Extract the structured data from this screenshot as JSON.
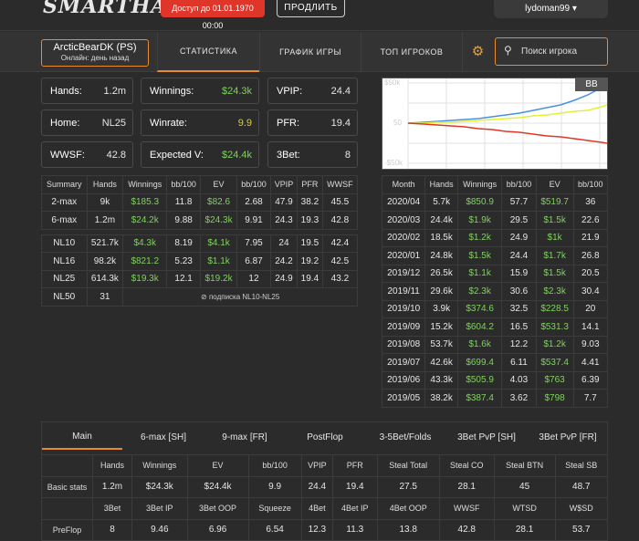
{
  "header": {
    "logo": "SMARTHAND",
    "subscription_badge": "Доступ до 01.01.1970 00:00",
    "renew_label": "ПРОДЛИТЬ",
    "username": "lydoman99"
  },
  "nav": {
    "player_name": "ArcticBearDK (PS)",
    "player_status": "Онлайн: день назад",
    "tabs": [
      "СТАТИСТИКА",
      "ГРАФИК ИГРЫ",
      "ТОП ИГРОКОВ"
    ],
    "active_tab": 0,
    "search_placeholder": "Поиск игрока"
  },
  "stats": [
    {
      "label": "Hands:",
      "value": "1.2m",
      "color": "white"
    },
    {
      "label": "Winnings:",
      "value": "$24.3k",
      "color": "green"
    },
    {
      "label": "VPIP:",
      "value": "24.4",
      "color": "white"
    },
    {
      "label": "Home:",
      "value": "NL25",
      "color": "white"
    },
    {
      "label": "Winrate:",
      "value": "9.9",
      "color": "yellow"
    },
    {
      "label": "PFR:",
      "value": "19.4",
      "color": "white"
    },
    {
      "label": "WWSF:",
      "value": "42.8",
      "color": "white"
    },
    {
      "label": "Expected V:",
      "value": "$24.4k",
      "color": "green"
    },
    {
      "label": "3Bet:",
      "value": "8",
      "color": "white"
    }
  ],
  "chart": {
    "tag": "BB",
    "y_labels": [
      "$50k",
      "50",
      "-$50k"
    ],
    "lines": [
      {
        "name": "EV",
        "color": "#4a90e2"
      },
      {
        "name": "Winnings",
        "color": "#e6f032"
      },
      {
        "name": "Red",
        "color": "#e0362a"
      }
    ]
  },
  "summary_table": {
    "headers": [
      "Summary",
      "Hands",
      "Winnings",
      "bb/100",
      "EV",
      "bb/100",
      "VPIP",
      "PFR",
      "WWSF"
    ],
    "rows": [
      [
        "2-max",
        "9k",
        "$185.3",
        "11.8",
        "$82.6",
        "2.68",
        "47.9",
        "38.2",
        "45.5"
      ],
      [
        "6-max",
        "1.2m",
        "$24.2k",
        "9.88",
        "$24.3k",
        "9.91",
        "24.3",
        "19.3",
        "42.8"
      ]
    ],
    "limit_rows": [
      [
        "NL10",
        "521.7k",
        "$4.3k",
        "8.19",
        "$4.1k",
        "7.95",
        "24",
        "19.5",
        "42.4"
      ],
      [
        "NL16",
        "98.2k",
        "$821.2",
        "5.23",
        "$1.1k",
        "6.87",
        "24.2",
        "19.2",
        "42.5"
      ],
      [
        "NL25",
        "614.3k",
        "$19.3k",
        "12.1",
        "$19.2k",
        "12",
        "24.9",
        "19.4",
        "43.2"
      ]
    ],
    "locked_row": {
      "limit": "NL50",
      "hands": "31",
      "note": "подписка NL10-NL25"
    }
  },
  "month_table": {
    "headers": [
      "Month",
      "Hands",
      "Winnings",
      "bb/100",
      "EV",
      "bb/100"
    ],
    "rows": [
      [
        "2020/04",
        "5.7k",
        "$850.9",
        "57.7",
        "$519.7",
        "36"
      ],
      [
        "2020/03",
        "24.4k",
        "$1.9k",
        "29.5",
        "$1.5k",
        "22.6"
      ],
      [
        "2020/02",
        "18.5k",
        "$1.2k",
        "24.9",
        "$1k",
        "21.9"
      ],
      [
        "2020/01",
        "24.8k",
        "$1.5k",
        "24.4",
        "$1.7k",
        "26.8"
      ],
      [
        "2019/12",
        "26.5k",
        "$1.1k",
        "15.9",
        "$1.5k",
        "20.5"
      ],
      [
        "2019/11",
        "29.6k",
        "$2.3k",
        "30.6",
        "$2.3k",
        "30.4"
      ],
      [
        "2019/10",
        "3.9k",
        "$374.6",
        "32.5",
        "$228.5",
        "20"
      ],
      [
        "2019/09",
        "15.2k",
        "$604.2",
        "16.5",
        "$531.3",
        "14.1"
      ],
      [
        "2019/08",
        "53.7k",
        "$1.6k",
        "12.2",
        "$1.2k",
        "9.03"
      ],
      [
        "2019/07",
        "42.6k",
        "$699.4",
        "6.11",
        "$537.4",
        "4.41"
      ],
      [
        "2019/06",
        "43.3k",
        "$505.9",
        "4.03",
        "$763",
        "6.39"
      ],
      [
        "2019/05",
        "38.2k",
        "$387.4",
        "3.62",
        "$798",
        "7.7"
      ]
    ]
  },
  "bottom_tabs": [
    "Main",
    "6-max [SH]",
    "9-max [FR]",
    "PostFlop",
    "3-5Bet/Folds",
    "3Bet PvP [SH]",
    "3Bet PvP [FR]"
  ],
  "grid": {
    "basic_headers": [
      "Hands",
      "Winnings",
      "EV",
      "bb/100",
      "VPIP",
      "PFR",
      "Steal Total",
      "Steal CO",
      "Steal BTN",
      "Steal SB"
    ],
    "basic_label": "Basic stats",
    "basic_values": [
      "1.2m",
      "$24.3k",
      "$24.4k",
      "9.9",
      "24.4",
      "19.4",
      "27.5",
      "28.1",
      "45",
      "48.7"
    ],
    "preflop_headers": [
      "3Bet",
      "3Bet IP",
      "3Bet OOP",
      "Squeeze",
      "4Bet",
      "4Bet IP",
      "4Bet OOP",
      "WWSF",
      "WTSD",
      "W$SD"
    ],
    "preflop_label": "PreFlop",
    "preflop_values": [
      "8",
      "9.46",
      "6.96",
      "6.54",
      "12.3",
      "11.3",
      "13.8",
      "42.8",
      "28.1",
      "53.7"
    ]
  }
}
